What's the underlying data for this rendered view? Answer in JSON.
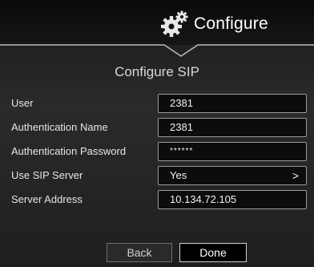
{
  "header": {
    "title": "Configure",
    "icon": "gears-icon"
  },
  "section": {
    "title": "Configure SIP"
  },
  "form": {
    "fields": [
      {
        "label": "User",
        "value": "2381"
      },
      {
        "label": "Authentication Name",
        "value": "2381"
      },
      {
        "label": "Authentication Password",
        "value": "******"
      },
      {
        "label": "Use SIP Server",
        "value": "Yes",
        "chevron": ">"
      },
      {
        "label": "Server Address",
        "value": "10.134.72.105"
      }
    ]
  },
  "buttons": {
    "back_label": "Back",
    "done_label": "Done"
  },
  "colors": {
    "background": "#1f1f1f",
    "field_border": "#9a9a9a",
    "text": "#ffffff"
  }
}
